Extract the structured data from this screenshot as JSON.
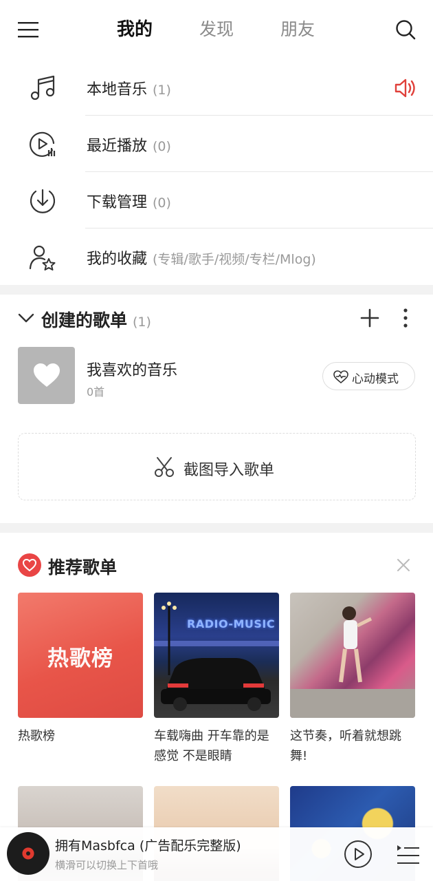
{
  "topbar": {
    "tabs": [
      {
        "label": "我的",
        "active": true
      },
      {
        "label": "发现",
        "active": false
      },
      {
        "label": "朋友",
        "active": false
      }
    ]
  },
  "local": [
    {
      "label": "本地音乐",
      "count": "(1)",
      "icon": "music-note-icon"
    },
    {
      "label": "最近播放",
      "count": "(0)",
      "icon": "recent-play-icon"
    },
    {
      "label": "下载管理",
      "count": "(0)",
      "icon": "download-icon"
    },
    {
      "label": "我的收藏",
      "count": "(专辑/歌手/视频/专栏/Mlog)",
      "icon": "user-star-icon"
    }
  ],
  "created": {
    "title": "创建的歌单",
    "count": "(1)",
    "playlist": {
      "name": "我喜欢的音乐",
      "sub": "0首",
      "mode_label": "心动模式"
    },
    "import_label": "截图导入歌单"
  },
  "recommended": {
    "title": "推荐歌单",
    "cards": [
      {
        "cover_text": "热歌榜",
        "caption": "热歌榜"
      },
      {
        "cover_text": "RADIO-MUSIC",
        "caption": "车载嗨曲 开车靠的是感觉 不是眼睛"
      },
      {
        "caption": "这节奏，听着就想跳舞!"
      }
    ]
  },
  "player": {
    "song": "拥有Masbfca (广告配乐完整版)",
    "hint": "横滑可以切换上下首哦"
  },
  "colors": {
    "accent": "#e94545",
    "speaker": "#e0403a"
  }
}
